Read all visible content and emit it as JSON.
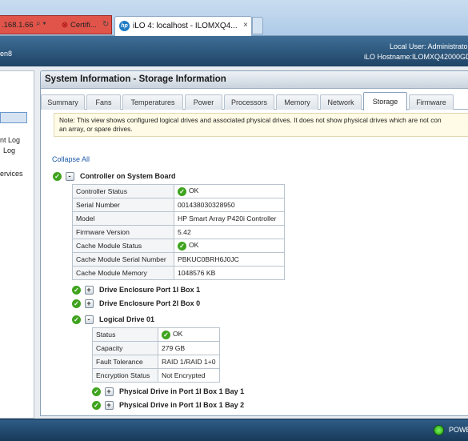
{
  "browser": {
    "address_fragment": ".168.1.66",
    "address_icons": "⌕ ▾",
    "cert_label": "Certifi...",
    "reload_icon": "↻",
    "tab_icon_text": "hp",
    "tab_title": "iLO 4: localhost - ILOMXQ4...",
    "tab_close": "×"
  },
  "header": {
    "brand_fragment": "en8",
    "local_user": "Local User:  Administrato",
    "hostname": "iLO Hostname:ILOMXQ42000GD"
  },
  "nav": {
    "items": [
      {
        "label": "nt Log"
      },
      {
        "label": "Log"
      },
      {
        "label": "ervices"
      }
    ]
  },
  "panel": {
    "title": "System Information - Storage Information",
    "tabs": [
      {
        "label": "Summary"
      },
      {
        "label": "Fans"
      },
      {
        "label": "Temperatures"
      },
      {
        "label": "Power"
      },
      {
        "label": "Processors"
      },
      {
        "label": "Memory"
      },
      {
        "label": "Network"
      },
      {
        "label": "Storage"
      },
      {
        "label": "Firmware"
      }
    ],
    "active_tab": "Storage",
    "note_line1": "Note: This view shows configured logical drives and associated physical drives. It does not show physical drives which are not con",
    "note_line2": "an array, or spare drives.",
    "collapse_all": "Collapse All"
  },
  "controller": {
    "title": "Controller on System Board",
    "toggle": "-",
    "rows": [
      {
        "key": "Controller Status",
        "value": "OK",
        "ok": true
      },
      {
        "key": "Serial Number",
        "value": "001438030328950"
      },
      {
        "key": "Model",
        "value": "HP Smart Array P420i Controller"
      },
      {
        "key": "Firmware Version",
        "value": "5.42"
      },
      {
        "key": "Cache Module Status",
        "value": "OK",
        "ok": true
      },
      {
        "key": "Cache Module Serial Number",
        "value": "PBKUC0BRH6J0JC"
      },
      {
        "key": "Cache Module Memory",
        "value": "1048576 KB"
      }
    ]
  },
  "enclosures": [
    {
      "title": "Drive Enclosure Port 1I Box 1",
      "toggle": "+"
    },
    {
      "title": "Drive Enclosure Port 2I Box 0",
      "toggle": "+"
    }
  ],
  "logical_drive": {
    "title": "Logical Drive 01",
    "toggle": "-",
    "rows": [
      {
        "key": "Status",
        "value": "OK",
        "ok": true
      },
      {
        "key": "Capacity",
        "value": "279 GB"
      },
      {
        "key": "Fault Tolerance",
        "value": "RAID 1/RAID 1+0"
      },
      {
        "key": "Encryption Status",
        "value": "Not Encrypted"
      }
    ]
  },
  "physical_drives": [
    {
      "title": "Physical Drive in Port 1I Box 1 Bay 1",
      "toggle": "+"
    },
    {
      "title": "Physical Drive in Port 1I Box 1 Bay 2",
      "toggle": "+"
    }
  ],
  "status_ok_glyph": "✓",
  "footer": {
    "power_label": "POWE"
  },
  "colors": {
    "header_blue": "#1f4466",
    "ok_green": "#3fa31e",
    "link_blue": "#1c5aa6",
    "active_tab_border": "#8ba3bc"
  }
}
